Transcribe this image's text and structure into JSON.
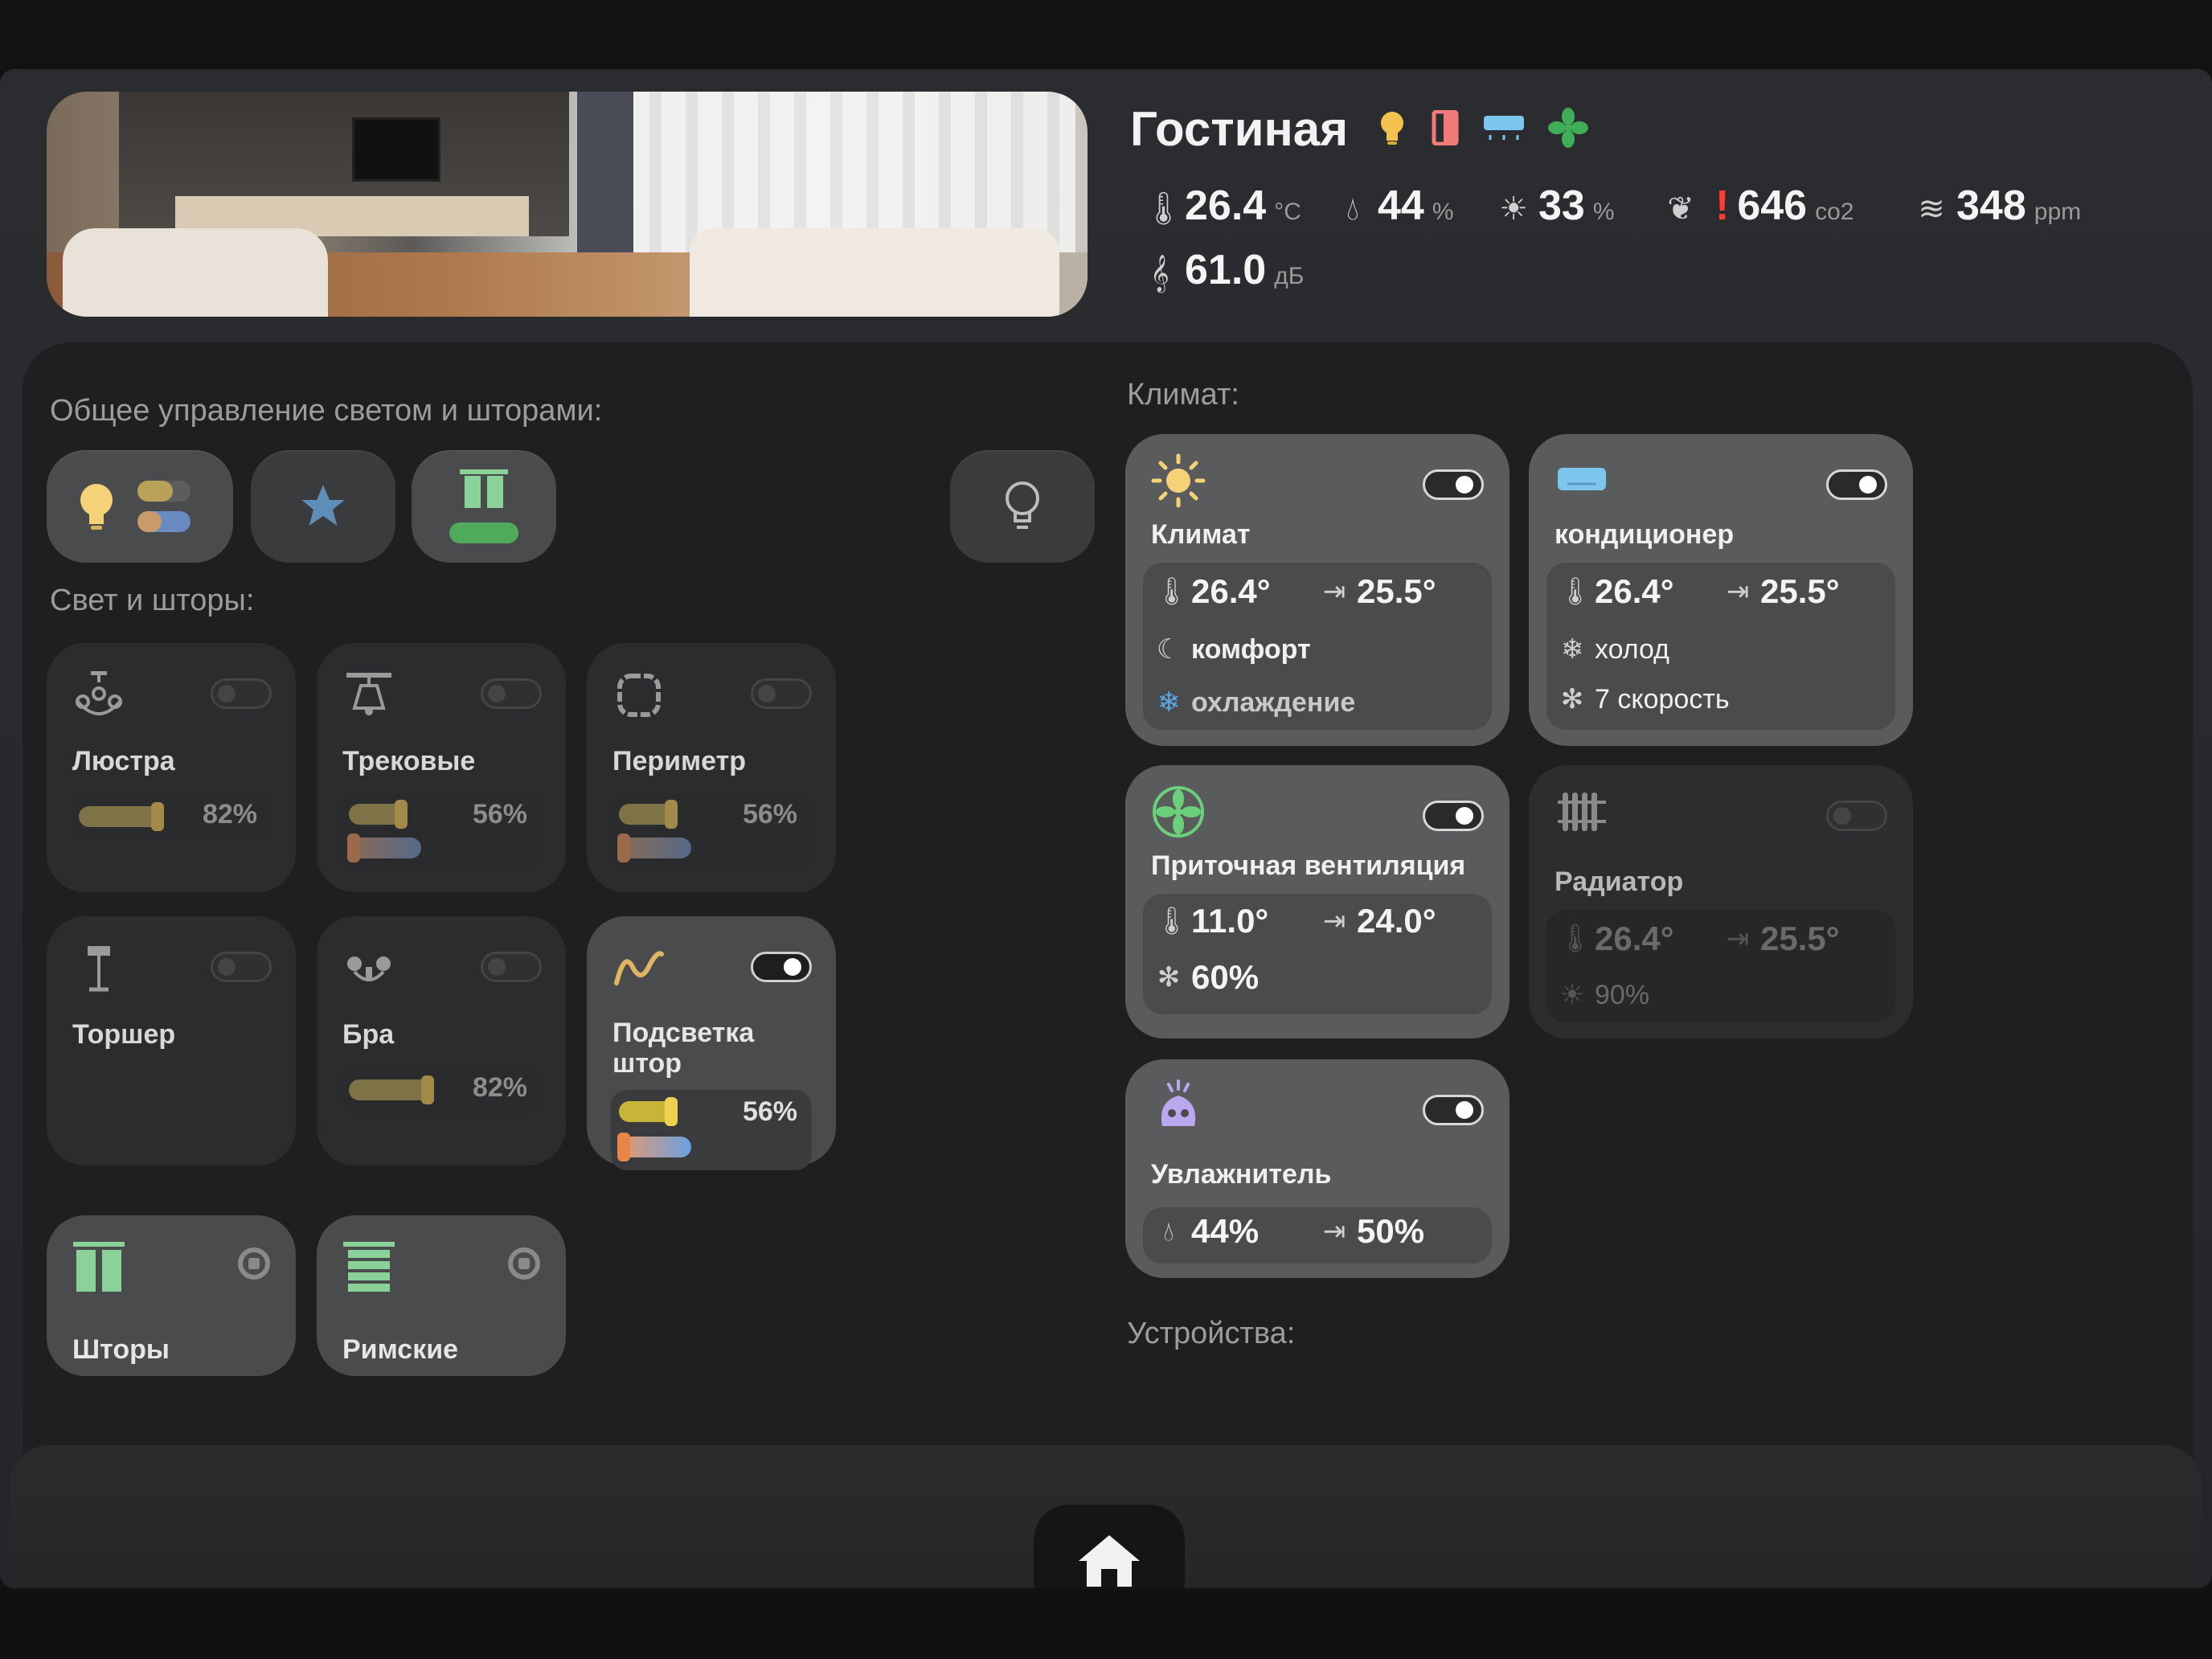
{
  "room": {
    "title": "Гостиная",
    "status_icons": [
      "bulb-icon",
      "door-icon",
      "ac-icon",
      "fan-icon"
    ]
  },
  "sensors": {
    "temperature": {
      "value": "26.4",
      "unit": "°C"
    },
    "humidity": {
      "value": "44",
      "unit": "%"
    },
    "illuminance": {
      "value": "33",
      "unit": "%"
    },
    "co2": {
      "alert": "!",
      "value": "646",
      "unit": "co2"
    },
    "air": {
      "value": "348",
      "unit": "ppm"
    },
    "noise": {
      "value": "61.0",
      "unit": "дБ"
    }
  },
  "lights_general": {
    "label": "Общее управление светом и шторами:"
  },
  "lights_section": {
    "label": "Свет и шторы:",
    "tiles": [
      {
        "name": "Люстра",
        "pct": "82%",
        "on": false,
        "brightness": 0.82
      },
      {
        "name": "Трековые",
        "pct": "56%",
        "on": false,
        "brightness": 0.56
      },
      {
        "name": "Периметр",
        "pct": "56%",
        "on": false,
        "brightness": 0.56
      },
      {
        "name": "Торшер",
        "on": false
      },
      {
        "name": "Бра",
        "pct": "82%",
        "on": false,
        "brightness": 0.82
      },
      {
        "name": "Подсветка\nштор",
        "pct": "56%",
        "on": true,
        "brightness": 0.56
      },
      {
        "name": "Шторы"
      },
      {
        "name": "Римские"
      }
    ]
  },
  "climate": {
    "label": "Климат:",
    "cards": [
      {
        "name": "Климат",
        "current": "26.4°",
        "target": "25.5°",
        "mode": "комфорт",
        "action": "охлаждение",
        "on": true
      },
      {
        "name": "кондиционер",
        "current": "26.4°",
        "target": "25.5°",
        "mode": "холод",
        "fan": "7 скорость",
        "on": true
      },
      {
        "name": "Приточная вентиляция",
        "current": "11.0°",
        "target": "24.0°",
        "fan": "60%",
        "on": true
      },
      {
        "name": "Радиатор",
        "current": "26.4°",
        "target": "25.5°",
        "power": "90%",
        "on": false
      },
      {
        "name": "Увлажнитель",
        "current": "44%",
        "target": "50%",
        "on": true
      }
    ]
  },
  "devices": {
    "label": "Устройства:"
  },
  "colors": {
    "accent_yellow": "#f2d36b",
    "accent_green": "#7be08a",
    "accent_blue": "#5aa9e6",
    "alert_red": "#ff3b30"
  }
}
